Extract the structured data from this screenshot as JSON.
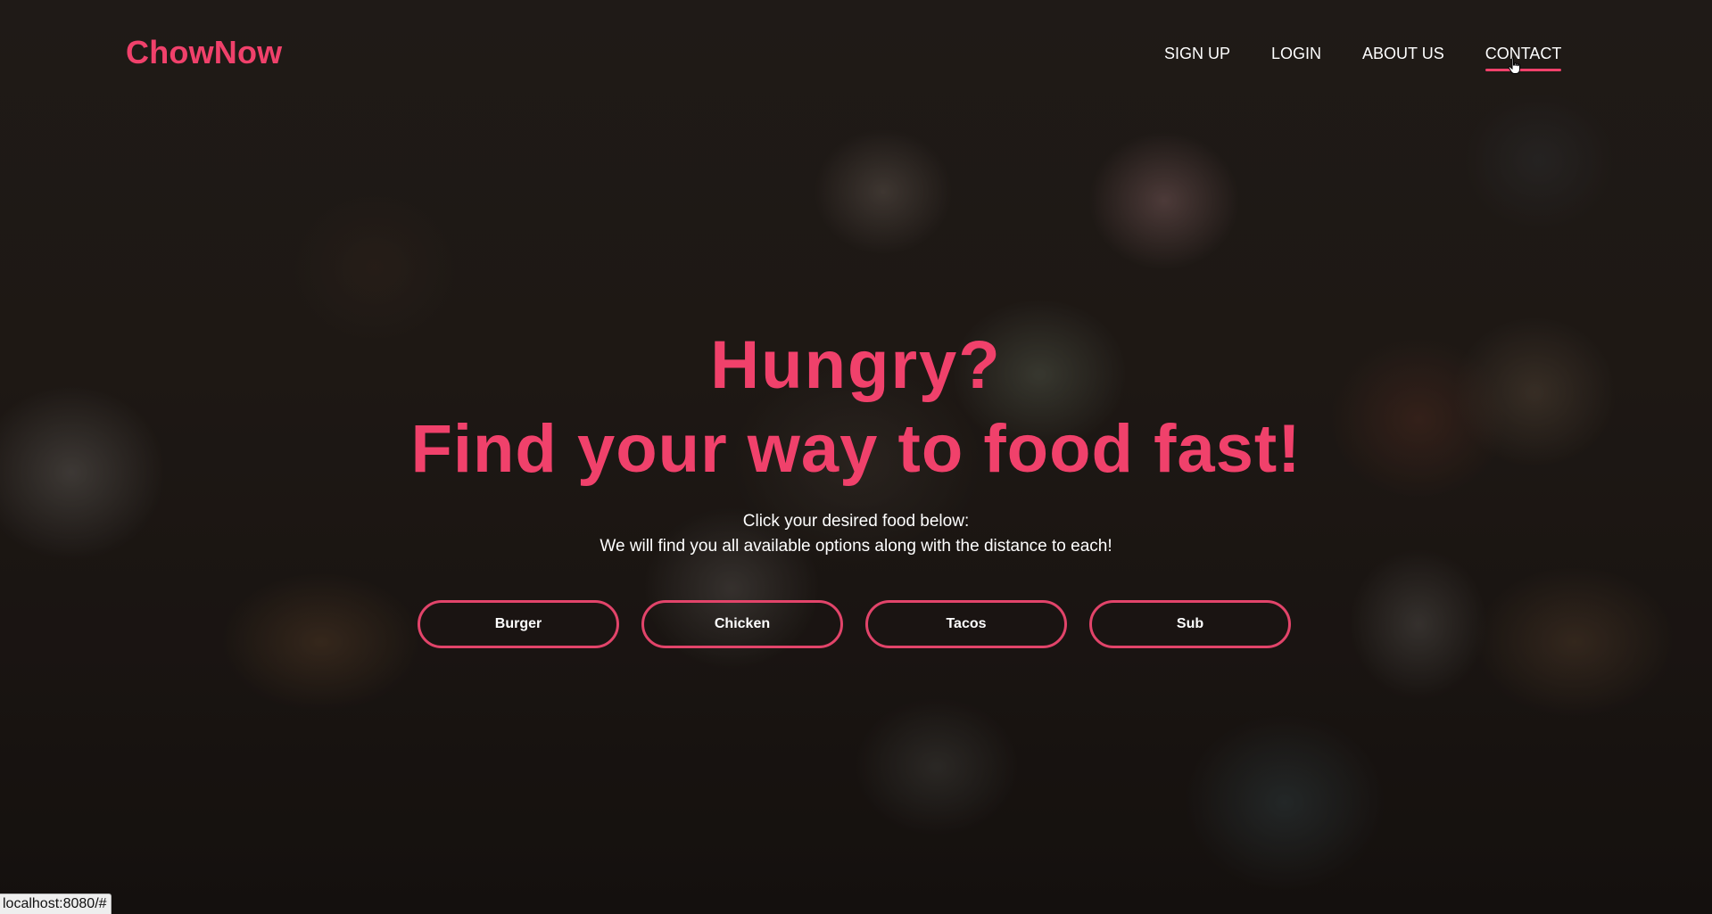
{
  "brand": {
    "name": "ChowNow",
    "accent_color": "#f0416b"
  },
  "nav": {
    "items": [
      {
        "label": "SIGN UP",
        "active": false
      },
      {
        "label": "LOGIN",
        "active": false
      },
      {
        "label": "ABOUT US",
        "active": false
      },
      {
        "label": "CONTACT",
        "active": true
      }
    ]
  },
  "hero": {
    "headline_1": "Hungry?",
    "headline_2": "Find your way to food fast!",
    "subtext_1": "Click your desired food below:",
    "subtext_2": "We will find you all available options along with the distance to each!",
    "background": "blurred overhead photo of a table with food dishes"
  },
  "food_options": [
    {
      "label": "Burger"
    },
    {
      "label": "Chicken"
    },
    {
      "label": "Tacos"
    },
    {
      "label": "Sub"
    }
  ],
  "status_bar": {
    "url": "localhost:8080/#"
  },
  "cursor": {
    "icon": "hand-pointer-icon"
  }
}
